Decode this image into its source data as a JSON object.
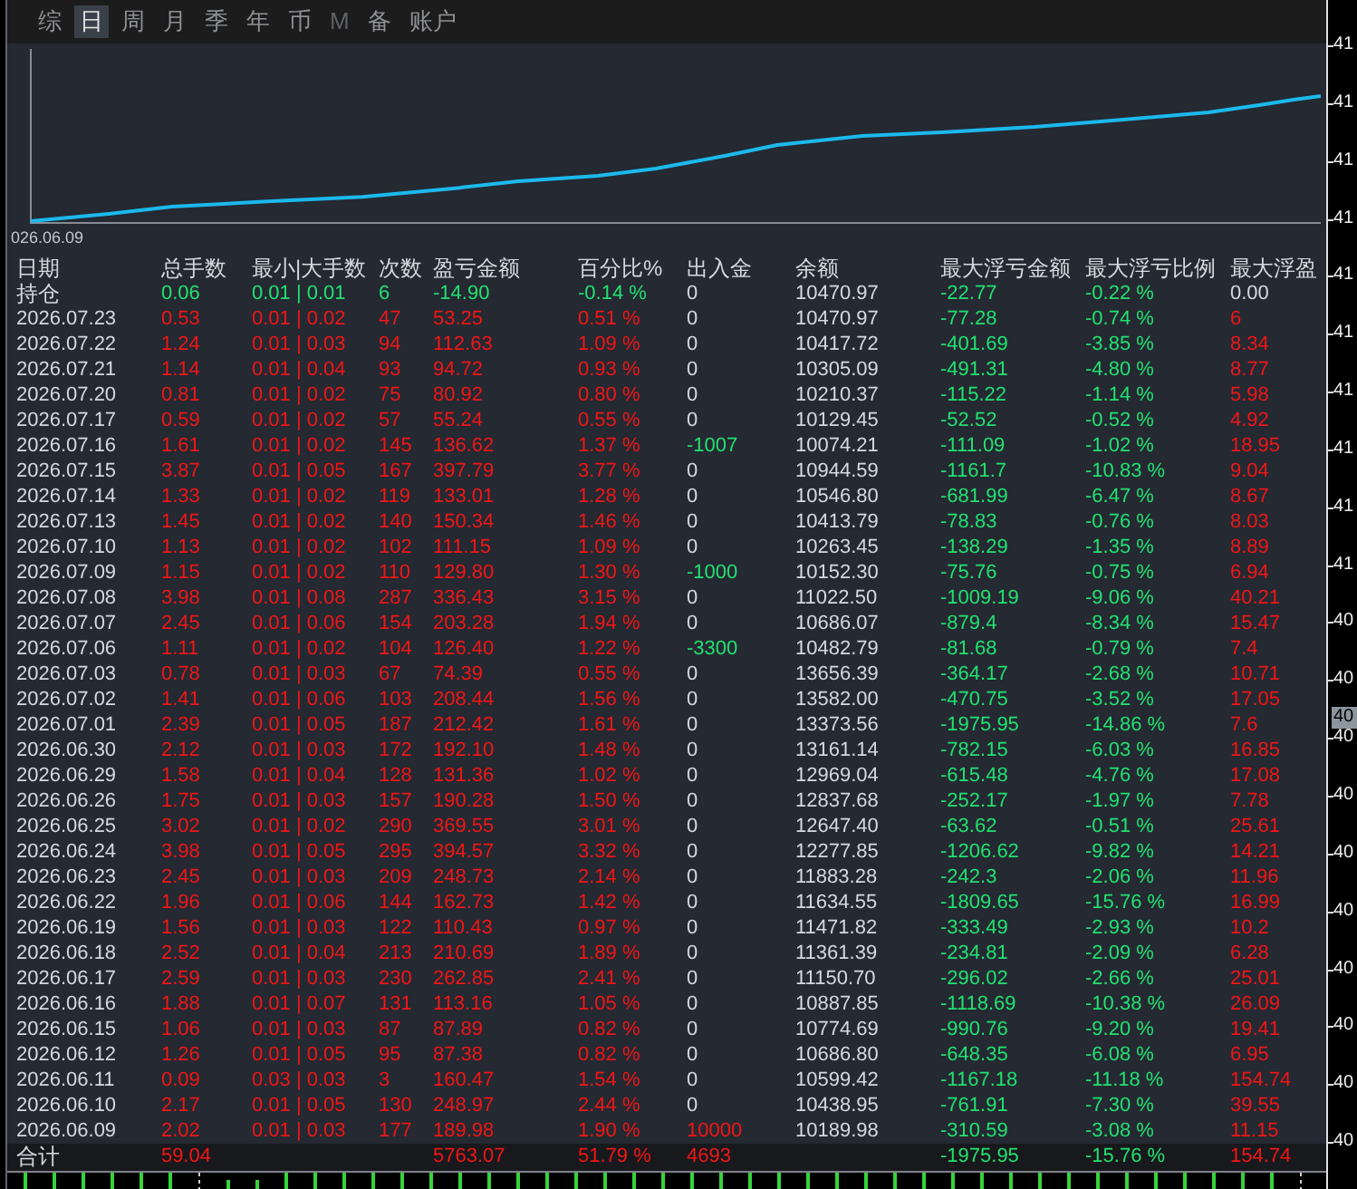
{
  "tabs": [
    {
      "label": "综",
      "selected": false,
      "disabled": false
    },
    {
      "label": "日",
      "selected": true,
      "disabled": false
    },
    {
      "label": "周",
      "selected": false,
      "disabled": false
    },
    {
      "label": "月",
      "selected": false,
      "disabled": false
    },
    {
      "label": "季",
      "selected": false,
      "disabled": false
    },
    {
      "label": "年",
      "selected": false,
      "disabled": false
    },
    {
      "label": "币",
      "selected": false,
      "disabled": false
    },
    {
      "label": "M",
      "selected": false,
      "disabled": true
    },
    {
      "label": "备",
      "selected": false,
      "disabled": false
    },
    {
      "label": "账户",
      "selected": false,
      "disabled": false
    }
  ],
  "chart": {
    "date_label": "026.06.09"
  },
  "table": {
    "columns": [
      "日期",
      "总手数",
      "最小|大手数",
      "次数",
      "盈亏金额",
      "百分比%",
      "出入金",
      "余额",
      "最大浮亏金额",
      "最大浮亏比例",
      "最大浮盈"
    ],
    "position_row": {
      "cells": [
        "持仓",
        "0.06",
        "0.01 | 0.01",
        "6",
        "-14.90",
        "-0.14 %",
        "0",
        "10470.97",
        "-22.77",
        "-0.22 %",
        "0.00"
      ],
      "kind": "flat"
    },
    "rows": [
      {
        "cells": [
          "2026.07.23",
          "0.53",
          "0.01 | 0.02",
          "47",
          "53.25",
          "0.51 %",
          "0",
          "10470.97",
          "-77.28",
          "-0.74 %",
          "6"
        ],
        "kind": "flat"
      },
      {
        "cells": [
          "2026.07.22",
          "1.24",
          "0.01 | 0.03",
          "94",
          "112.63",
          "1.09 %",
          "0",
          "10417.72",
          "-401.69",
          "-3.85 %",
          "8.34"
        ],
        "kind": "flat"
      },
      {
        "cells": [
          "2026.07.21",
          "1.14",
          "0.01 | 0.04",
          "93",
          "94.72",
          "0.93 %",
          "0",
          "10305.09",
          "-491.31",
          "-4.80 %",
          "8.77"
        ],
        "kind": "flat"
      },
      {
        "cells": [
          "2026.07.20",
          "0.81",
          "0.01 | 0.02",
          "75",
          "80.92",
          "0.80 %",
          "0",
          "10210.37",
          "-115.22",
          "-1.14 %",
          "5.98"
        ],
        "kind": "flat"
      },
      {
        "cells": [
          "2026.07.17",
          "0.59",
          "0.01 | 0.02",
          "57",
          "55.24",
          "0.55 %",
          "0",
          "10129.45",
          "-52.52",
          "-0.52 %",
          "4.92"
        ],
        "kind": "flat"
      },
      {
        "cells": [
          "2026.07.16",
          "1.61",
          "0.01 | 0.02",
          "145",
          "136.62",
          "1.37 %",
          "-1007",
          "10074.21",
          "-111.09",
          "-1.02 %",
          "18.95"
        ],
        "kind": "withdrawal"
      },
      {
        "cells": [
          "2026.07.15",
          "3.87",
          "0.01 | 0.05",
          "167",
          "397.79",
          "3.77 %",
          "0",
          "10944.59",
          "-1161.7",
          "-10.83 %",
          "9.04"
        ],
        "kind": "flat"
      },
      {
        "cells": [
          "2026.07.14",
          "1.33",
          "0.01 | 0.02",
          "119",
          "133.01",
          "1.28 %",
          "0",
          "10546.80",
          "-681.99",
          "-6.47 %",
          "8.67"
        ],
        "kind": "flat"
      },
      {
        "cells": [
          "2026.07.13",
          "1.45",
          "0.01 | 0.02",
          "140",
          "150.34",
          "1.46 %",
          "0",
          "10413.79",
          "-78.83",
          "-0.76 %",
          "8.03"
        ],
        "kind": "flat"
      },
      {
        "cells": [
          "2026.07.10",
          "1.13",
          "0.01 | 0.02",
          "102",
          "111.15",
          "1.09 %",
          "0",
          "10263.45",
          "-138.29",
          "-1.35 %",
          "8.89"
        ],
        "kind": "flat"
      },
      {
        "cells": [
          "2026.07.09",
          "1.15",
          "0.01 | 0.02",
          "110",
          "129.80",
          "1.30 %",
          "-1000",
          "10152.30",
          "-75.76",
          "-0.75 %",
          "6.94"
        ],
        "kind": "withdrawal"
      },
      {
        "cells": [
          "2026.07.08",
          "3.98",
          "0.01 | 0.08",
          "287",
          "336.43",
          "3.15 %",
          "0",
          "11022.50",
          "-1009.19",
          "-9.06 %",
          "40.21"
        ],
        "kind": "flat"
      },
      {
        "cells": [
          "2026.07.07",
          "2.45",
          "0.01 | 0.06",
          "154",
          "203.28",
          "1.94 %",
          "0",
          "10686.07",
          "-879.4",
          "-8.34 %",
          "15.47"
        ],
        "kind": "flat"
      },
      {
        "cells": [
          "2026.07.06",
          "1.11",
          "0.01 | 0.02",
          "104",
          "126.40",
          "1.22 %",
          "-3300",
          "10482.79",
          "-81.68",
          "-0.79 %",
          "7.4"
        ],
        "kind": "withdrawal"
      },
      {
        "cells": [
          "2026.07.03",
          "0.78",
          "0.01 | 0.03",
          "67",
          "74.39",
          "0.55 %",
          "0",
          "13656.39",
          "-364.17",
          "-2.68 %",
          "10.71"
        ],
        "kind": "flat"
      },
      {
        "cells": [
          "2026.07.02",
          "1.41",
          "0.01 | 0.06",
          "103",
          "208.44",
          "1.56 %",
          "0",
          "13582.00",
          "-470.75",
          "-3.52 %",
          "17.05"
        ],
        "kind": "flat"
      },
      {
        "cells": [
          "2026.07.01",
          "2.39",
          "0.01 | 0.05",
          "187",
          "212.42",
          "1.61 %",
          "0",
          "13373.56",
          "-1975.95",
          "-14.86 %",
          "7.6"
        ],
        "kind": "flat"
      },
      {
        "cells": [
          "2026.06.30",
          "2.12",
          "0.01 | 0.03",
          "172",
          "192.10",
          "1.48 %",
          "0",
          "13161.14",
          "-782.15",
          "-6.03 %",
          "16.85"
        ],
        "kind": "flat"
      },
      {
        "cells": [
          "2026.06.29",
          "1.58",
          "0.01 | 0.04",
          "128",
          "131.36",
          "1.02 %",
          "0",
          "12969.04",
          "-615.48",
          "-4.76 %",
          "17.08"
        ],
        "kind": "flat"
      },
      {
        "cells": [
          "2026.06.26",
          "1.75",
          "0.01 | 0.03",
          "157",
          "190.28",
          "1.50 %",
          "0",
          "12837.68",
          "-252.17",
          "-1.97 %",
          "7.78"
        ],
        "kind": "flat"
      },
      {
        "cells": [
          "2026.06.25",
          "3.02",
          "0.01 | 0.02",
          "290",
          "369.55",
          "3.01 %",
          "0",
          "12647.40",
          "-63.62",
          "-0.51 %",
          "25.61"
        ],
        "kind": "flat"
      },
      {
        "cells": [
          "2026.06.24",
          "3.98",
          "0.01 | 0.05",
          "295",
          "394.57",
          "3.32 %",
          "0",
          "12277.85",
          "-1206.62",
          "-9.82 %",
          "14.21"
        ],
        "kind": "flat"
      },
      {
        "cells": [
          "2026.06.23",
          "2.45",
          "0.01 | 0.03",
          "209",
          "248.73",
          "2.14 %",
          "0",
          "11883.28",
          "-242.3",
          "-2.06 %",
          "11.96"
        ],
        "kind": "flat"
      },
      {
        "cells": [
          "2026.06.22",
          "1.96",
          "0.01 | 0.06",
          "144",
          "162.73",
          "1.42 %",
          "0",
          "11634.55",
          "-1809.65",
          "-15.76 %",
          "16.99"
        ],
        "kind": "flat"
      },
      {
        "cells": [
          "2026.06.19",
          "1.56",
          "0.01 | 0.03",
          "122",
          "110.43",
          "0.97 %",
          "0",
          "11471.82",
          "-333.49",
          "-2.93 %",
          "10.2"
        ],
        "kind": "flat"
      },
      {
        "cells": [
          "2026.06.18",
          "2.52",
          "0.01 | 0.04",
          "213",
          "210.69",
          "1.89 %",
          "0",
          "11361.39",
          "-234.81",
          "-2.09 %",
          "6.28"
        ],
        "kind": "flat"
      },
      {
        "cells": [
          "2026.06.17",
          "2.59",
          "0.01 | 0.03",
          "230",
          "262.85",
          "2.41 %",
          "0",
          "11150.70",
          "-296.02",
          "-2.66 %",
          "25.01"
        ],
        "kind": "flat"
      },
      {
        "cells": [
          "2026.06.16",
          "1.88",
          "0.01 | 0.07",
          "131",
          "113.16",
          "1.05 %",
          "0",
          "10887.85",
          "-1118.69",
          "-10.38 %",
          "26.09"
        ],
        "kind": "flat"
      },
      {
        "cells": [
          "2026.06.15",
          "1.06",
          "0.01 | 0.03",
          "87",
          "87.89",
          "0.82 %",
          "0",
          "10774.69",
          "-990.76",
          "-9.20 %",
          "19.41"
        ],
        "kind": "flat"
      },
      {
        "cells": [
          "2026.06.12",
          "1.26",
          "0.01 | 0.05",
          "95",
          "87.38",
          "0.82 %",
          "0",
          "10686.80",
          "-648.35",
          "-6.08 %",
          "6.95"
        ],
        "kind": "flat"
      },
      {
        "cells": [
          "2026.06.11",
          "0.09",
          "0.03 | 0.03",
          "3",
          "160.47",
          "1.54 %",
          "0",
          "10599.42",
          "-1167.18",
          "-11.18 %",
          "154.74"
        ],
        "kind": "flat"
      },
      {
        "cells": [
          "2026.06.10",
          "2.17",
          "0.01 | 0.05",
          "130",
          "248.97",
          "2.44 %",
          "0",
          "10438.95",
          "-761.91",
          "-7.30 %",
          "39.55"
        ],
        "kind": "flat"
      },
      {
        "cells": [
          "2026.06.09",
          "2.02",
          "0.01 | 0.03",
          "177",
          "189.98",
          "1.90 %",
          "10000",
          "10189.98",
          "-310.59",
          "-3.08 %",
          "11.15"
        ],
        "kind": "deposit"
      }
    ],
    "total_row": {
      "label": "合计",
      "lots": "59.04",
      "pnl": "5763.07",
      "pct": "51.79 %",
      "flow": "4693",
      "kind": "deposit",
      "max_loss": "-1975.95",
      "max_loss_pct": "-15.76 %",
      "max_gain": "154.74"
    }
  },
  "price_axis": {
    "labels": [
      "41",
      "41",
      "41",
      "41",
      "41",
      "41",
      "41",
      "41",
      "41",
      "41",
      "40",
      "40",
      "40",
      "40",
      "40",
      "40",
      "40",
      "40",
      "40",
      "40"
    ],
    "current_price": "40"
  }
}
